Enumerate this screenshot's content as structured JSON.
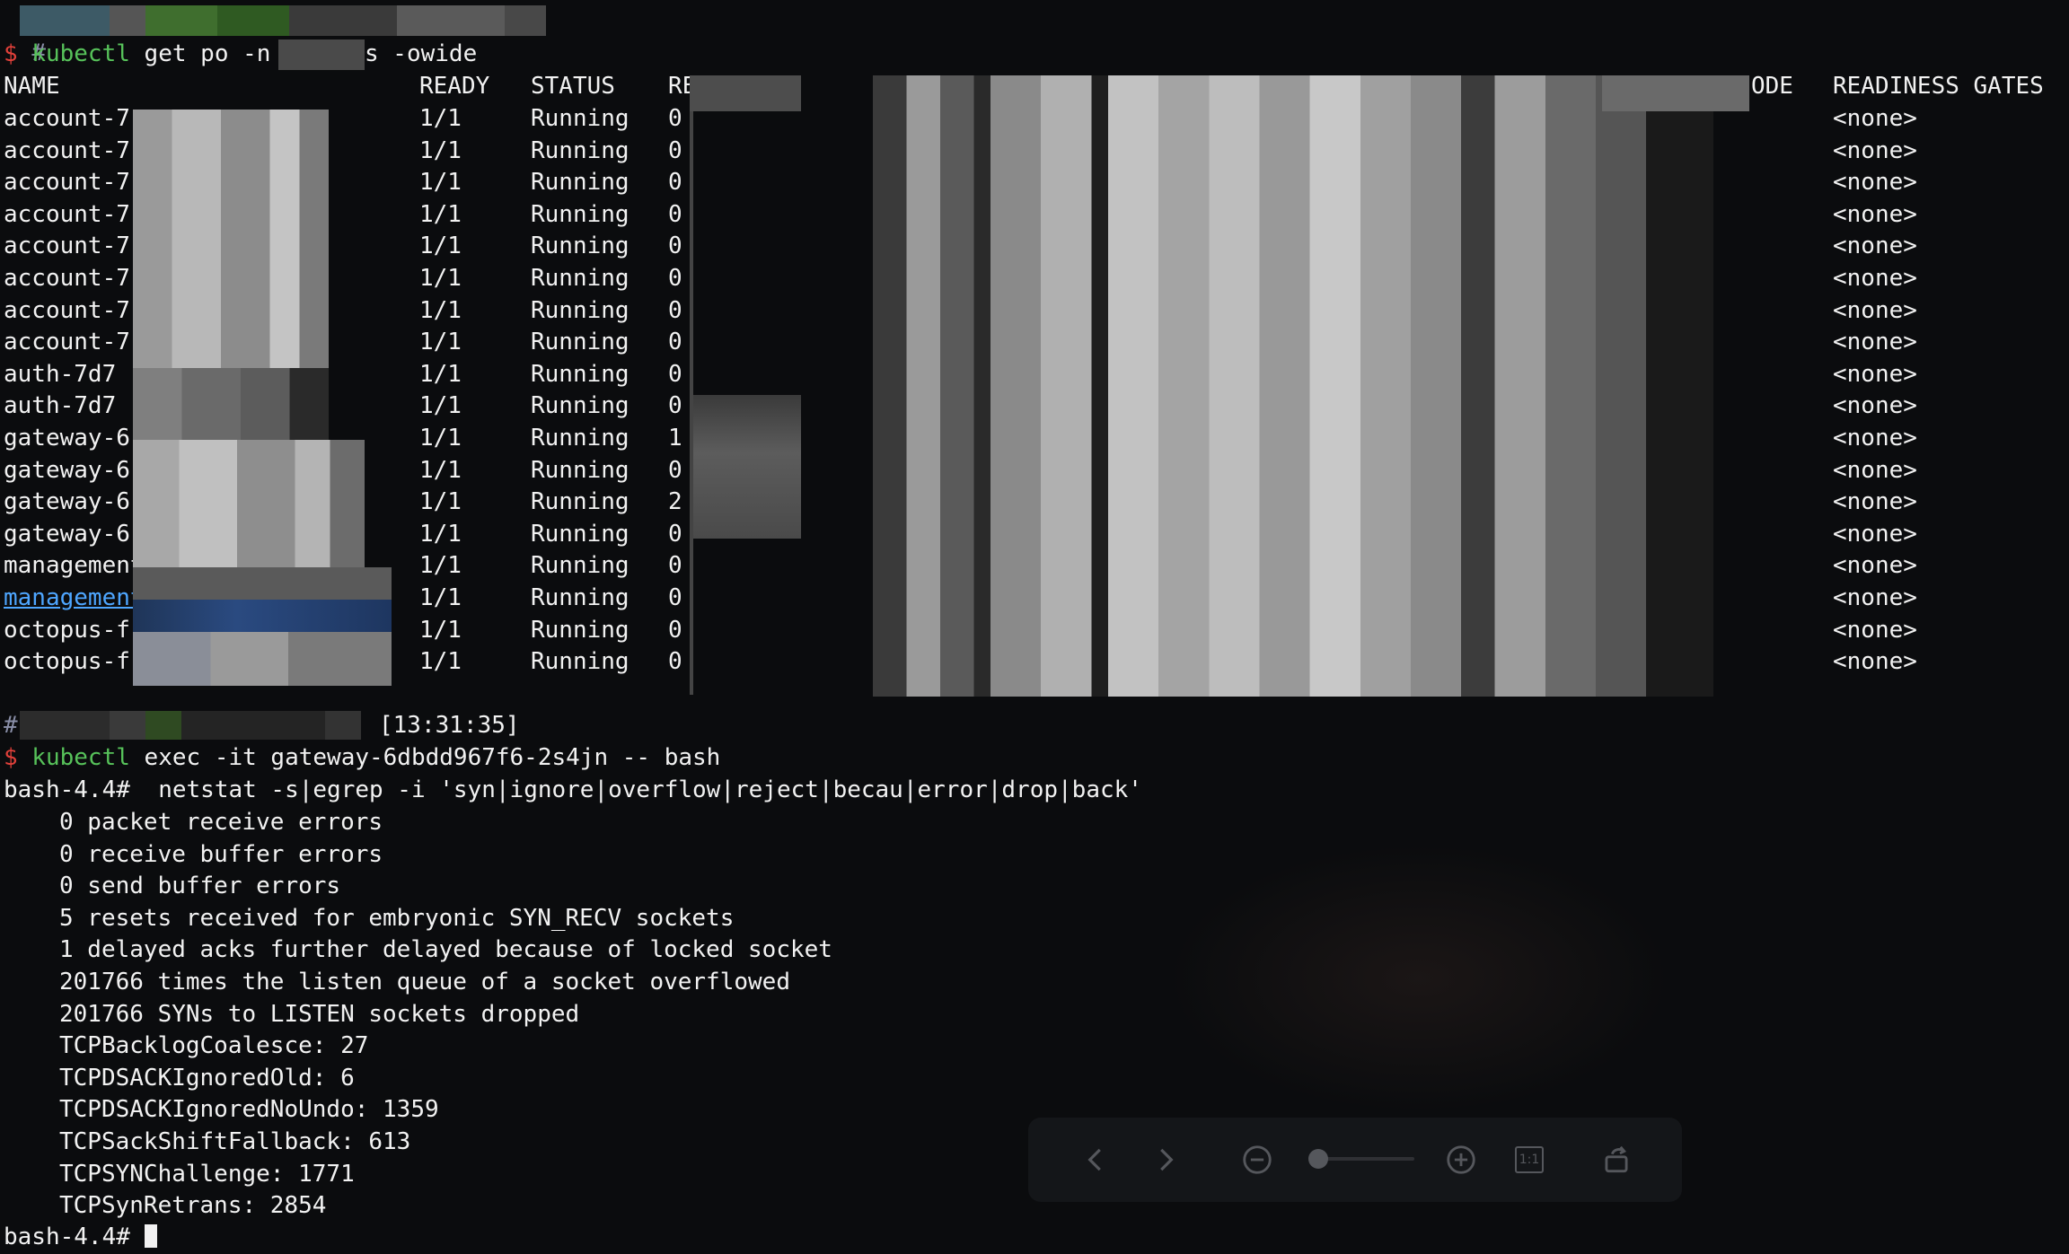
{
  "colors": {
    "background": "#0b0c0e",
    "text": "#f2f2f2",
    "prompt_dollar": "#e0403a",
    "command": "#57c25a",
    "link": "#4ea6ff"
  },
  "prompt1": {
    "hash": "#",
    "dollar": "$",
    "command": "kubectl",
    "args_a": "get po -n",
    "args_b": "s -owide"
  },
  "table": {
    "headers": {
      "name": "NAME",
      "ready": "READY",
      "status": "STATUS",
      "restarts": "RE",
      "node": "ODE",
      "readiness_gates": "READINESS GATES"
    },
    "rows": [
      {
        "name": "account-7",
        "ready": "1/1",
        "status": "Running",
        "restarts": "0",
        "gates": "<none>"
      },
      {
        "name": "account-7",
        "ready": "1/1",
        "status": "Running",
        "restarts": "0",
        "gates": "<none>"
      },
      {
        "name": "account-7",
        "ready": "1/1",
        "status": "Running",
        "restarts": "0",
        "gates": "<none>"
      },
      {
        "name": "account-7",
        "ready": "1/1",
        "status": "Running",
        "restarts": "0",
        "gates": "<none>"
      },
      {
        "name": "account-7",
        "ready": "1/1",
        "status": "Running",
        "restarts": "0",
        "gates": "<none>"
      },
      {
        "name": "account-7",
        "ready": "1/1",
        "status": "Running",
        "restarts": "0",
        "gates": "<none>"
      },
      {
        "name": "account-7",
        "ready": "1/1",
        "status": "Running",
        "restarts": "0",
        "gates": "<none>"
      },
      {
        "name": "account-7",
        "ready": "1/1",
        "status": "Running",
        "restarts": "0",
        "gates": "<none>"
      },
      {
        "name": "auth-7d7",
        "ready": "1/1",
        "status": "Running",
        "restarts": "0",
        "gates": "<none>"
      },
      {
        "name": "auth-7d7",
        "ready": "1/1",
        "status": "Running",
        "restarts": "0",
        "gates": "<none>"
      },
      {
        "name": "gateway-6",
        "ready": "1/1",
        "status": "Running",
        "restarts": "1",
        "gates": "<none>"
      },
      {
        "name": "gateway-6",
        "ready": "1/1",
        "status": "Running",
        "restarts": "0",
        "gates": "<none>"
      },
      {
        "name": "gateway-6",
        "ready": "1/1",
        "status": "Running",
        "restarts": "2",
        "gates": "<none>"
      },
      {
        "name": "gateway-6",
        "ready": "1/1",
        "status": "Running",
        "restarts": "0",
        "gates": "<none>"
      },
      {
        "name": "management",
        "ready": "1/1",
        "status": "Running",
        "restarts": "0",
        "gates": "<none>"
      },
      {
        "name": "management",
        "ready": "1/1",
        "status": "Running",
        "restarts": "0",
        "gates": "<none>"
      },
      {
        "name": "octopus-f",
        "ready": "1/1",
        "status": "Running",
        "restarts": "0",
        "gates": "<none>"
      },
      {
        "name": "octopus-f",
        "ready": "1/1",
        "status": "Running",
        "restarts": "0",
        "gates": "<none>"
      }
    ]
  },
  "prompt2": {
    "hash": "#",
    "time": "[13:31:35]",
    "dollar": "$",
    "command": "kubectl",
    "args": "exec -it gateway-6dbdd967f6-2s4jn -- bash"
  },
  "shell": {
    "prompt": "bash-4.4#",
    "netstat_cmd": "netstat -s|egrep -i 'syn|ignore|overflow|reject|becau|error|drop|back'",
    "output": [
      "0 packet receive errors",
      "0 receive buffer errors",
      "0 send buffer errors",
      "5 resets received for embryonic SYN_RECV sockets",
      "1 delayed acks further delayed because of locked socket",
      "201766 times the listen queue of a socket overflowed",
      "201766 SYNs to LISTEN sockets dropped",
      "TCPBacklogCoalesce: 27",
      "TCPDSACKIgnoredOld: 6",
      "TCPDSACKIgnoredNoUndo: 1359",
      "TCPSackShiftFallback: 613",
      "TCPSYNChallenge: 1771",
      "TCPSynRetrans: 2854"
    ],
    "final_prompt": "bash-4.4#"
  },
  "viewer_toolbar": {
    "icons": [
      "chevron-left-icon",
      "chevron-right-icon",
      "zoom-out-icon",
      "zoom-slider",
      "zoom-in-icon",
      "actual-size-icon",
      "rotate-icon"
    ],
    "actual_size_label": "1:1"
  }
}
